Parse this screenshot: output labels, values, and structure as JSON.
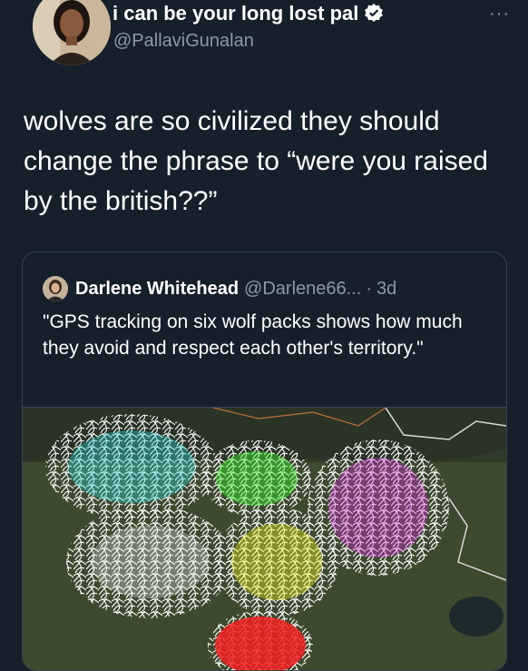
{
  "author": {
    "display_name": "i can be your long lost pal",
    "handle": "@PallaviGunalan"
  },
  "icons": {
    "verified": "verified-badge-icon",
    "more": "more-options-icon"
  },
  "more_label": "···",
  "tweet": {
    "text": "wolves are so civilized they should change the phrase to “were you raised by the british??”"
  },
  "quoted_tweet": {
    "display_name": "Darlene Whitehead",
    "handle": "@Darlene66...",
    "separator": "·",
    "time": "3d",
    "text": "\"GPS tracking on six wolf packs shows how much they avoid and respect each other's territory.\"",
    "media": {
      "description_colors": [
        "#22e0e0",
        "#33ee22",
        "#e024e0",
        "#f4f4f4",
        "#f0f020",
        "#f02020"
      ]
    }
  },
  "colors": {
    "background": "#15202b",
    "secondary_text": "#8b98a5",
    "border": "#38444d",
    "verified": "#1d9bf0"
  }
}
